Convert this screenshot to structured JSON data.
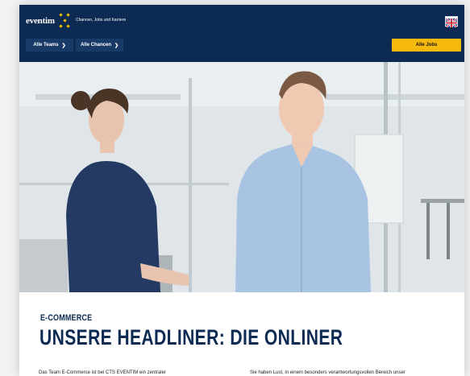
{
  "header": {
    "brand": "eventim",
    "tagline": "Chancen, Jobs und Karriere",
    "language_flag": "uk-flag-icon",
    "nav": [
      {
        "label": "Alle Teams",
        "icon": "chevron-right-icon"
      },
      {
        "label": "Alle Chancen",
        "icon": "chevron-right-icon"
      }
    ],
    "jobs_button": "Alle Jobs"
  },
  "colors": {
    "header_bg": "#0d2b52",
    "accent": "#f6b90d",
    "headline": "#0d2b52"
  },
  "hero": {
    "image": "hero-photo"
  },
  "content": {
    "section_label": "E-COMMERCE",
    "headline": "UNSERE HEADLINER: DIE ONLINER",
    "col1_text": "Das Team E-Commerce ist bei CTS EVENTIM ein zentraler",
    "col2_text": "Sie haben Lust, in einem besonders verantwortungsvollen Bereich unser"
  }
}
